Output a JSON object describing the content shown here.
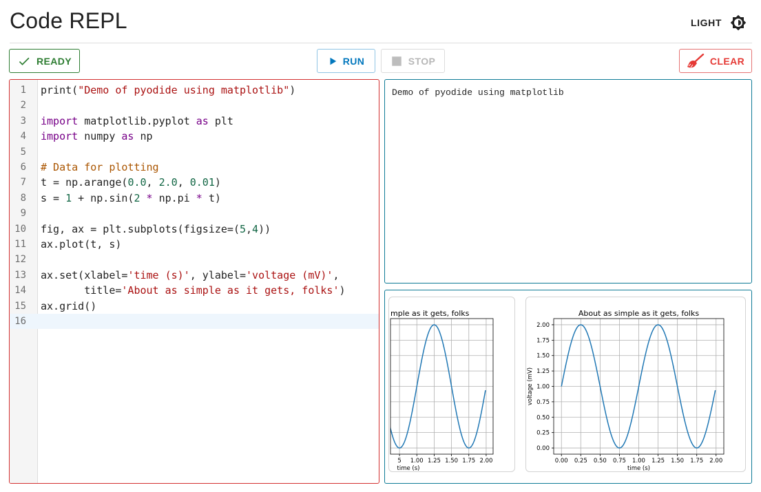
{
  "header": {
    "title": "Code REPL",
    "theme_label": "LIGHT",
    "theme_icon": "brightness-icon"
  },
  "toolbar": {
    "ready_label": "READY",
    "ready_icon": "check-icon",
    "run_label": "RUN",
    "run_icon": "play-icon",
    "stop_label": "STOP",
    "stop_icon": "stop-square-icon",
    "clear_label": "CLEAR",
    "clear_icon": "broom-icon"
  },
  "editor": {
    "active_line": 16,
    "lines": [
      "print(\"Demo of pyodide using matplotlib\")",
      "",
      "import matplotlib.pyplot as plt",
      "import numpy as np",
      "",
      "# Data for plotting",
      "t = np.arange(0.0, 2.0, 0.01)",
      "s = 1 + np.sin(2 * np.pi * t)",
      "",
      "fig, ax = plt.subplots(figsize=(5,4))",
      "ax.plot(t, s)",
      "",
      "ax.set(xlabel='time (s)', ylabel='voltage (mV)',",
      "       title='About as simple as it gets, folks')",
      "ax.grid()",
      ""
    ]
  },
  "output": {
    "text": "Demo of pyodide using matplotlib"
  },
  "colors": {
    "ready": "#2e7d32",
    "run": "#0277bd",
    "clear": "#e53935",
    "editor_border": "#d32f2f",
    "panel_border": "#0c7a96",
    "plot_line": "#1f77b4"
  },
  "chart_data": [
    {
      "type": "line",
      "title": "mple as it gets, folks",
      "xlabel": "time (s)",
      "ylabel": "",
      "x_ticks": [
        "5",
        "1.00",
        "1.25",
        "1.50",
        "1.75",
        "2.00"
      ],
      "xlim": [
        0.62,
        2.1
      ],
      "ylim": [
        -0.1,
        2.1
      ],
      "grid": true,
      "series": [
        {
          "function": "1 + sin(2*pi*t)",
          "t_start": 0.0,
          "t_end": 1.99,
          "t_step": 0.01
        }
      ]
    },
    {
      "type": "line",
      "title": "About as simple as it gets, folks",
      "xlabel": "time (s)",
      "ylabel": "voltage (mV)",
      "x_ticks": [
        "0.00",
        "0.25",
        "0.50",
        "0.75",
        "1.00",
        "1.25",
        "1.50",
        "1.75",
        "2.00"
      ],
      "y_ticks": [
        "0.00",
        "0.25",
        "0.50",
        "0.75",
        "1.00",
        "1.25",
        "1.50",
        "1.75",
        "2.00"
      ],
      "xlim": [
        -0.1,
        2.1
      ],
      "ylim": [
        -0.1,
        2.1
      ],
      "grid": true,
      "series": [
        {
          "function": "1 + sin(2*pi*t)",
          "t_start": 0.0,
          "t_end": 1.99,
          "t_step": 0.01
        }
      ]
    }
  ]
}
